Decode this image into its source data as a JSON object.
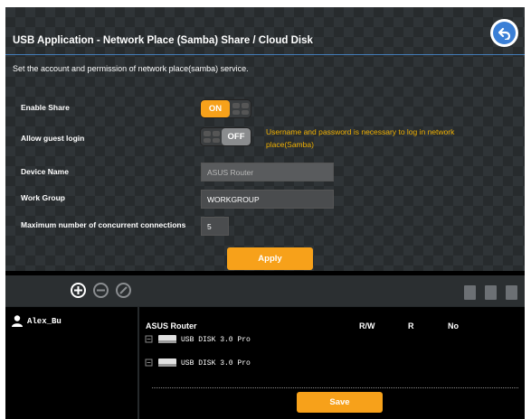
{
  "header": {
    "title": "USB Application - Network Place (Samba) Share / Cloud Disk",
    "back_icon": "back-arrow-icon"
  },
  "description": "Set the account and permission of network place(samba) service.",
  "settings": {
    "enable_share": {
      "label": "Enable Share",
      "state": "ON"
    },
    "guest_login": {
      "label": "Allow guest login",
      "state": "OFF",
      "note": "Username and password is necessary to log in network place(Samba)"
    },
    "device_name": {
      "label": "Device Name",
      "value": "ASUS Router"
    },
    "work_group": {
      "label": "Work Group",
      "value": "WORKGROUP"
    },
    "max_connections": {
      "label": "Maximum number of concurrent connections",
      "value": "5"
    }
  },
  "apply_label": "Apply",
  "toolbar": {
    "icons": [
      "add-icon",
      "remove-icon",
      "edit-icon",
      "add-folder-icon",
      "delete-folder-icon",
      "edit-folder-icon"
    ]
  },
  "users": [
    {
      "name": "Alex_Bu"
    }
  ],
  "permissions": {
    "device": "ASUS Router",
    "columns": {
      "rw": "R/W",
      "r": "R",
      "no": "No"
    },
    "disks": [
      {
        "label": "USB DISK 3.0 Pro"
      },
      {
        "label": "USB DISK 3.0 Pro"
      }
    ]
  },
  "save_label": "Save",
  "colors": {
    "accent": "#f7a11a",
    "note": "#f0b000",
    "link": "#4a90d9"
  }
}
